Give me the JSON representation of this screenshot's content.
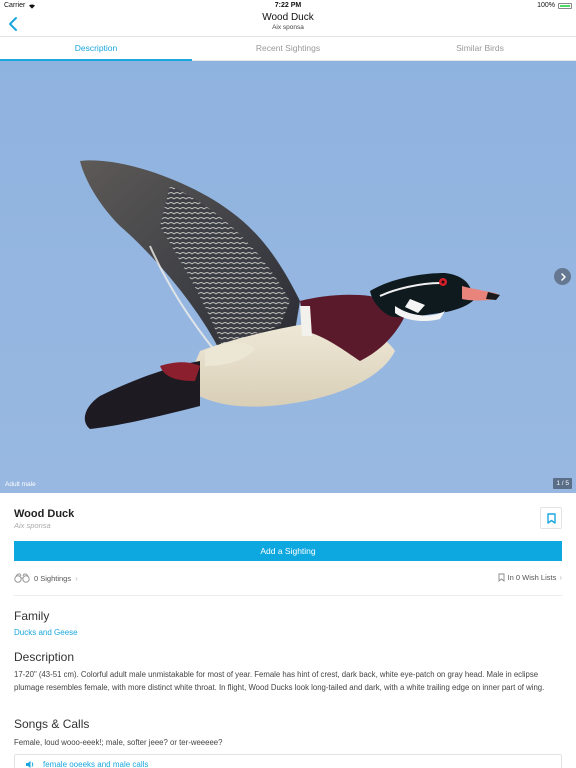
{
  "status_bar": {
    "carrier": "Carrier",
    "time": "7:22 PM",
    "battery": "100%"
  },
  "nav": {
    "title": "Wood Duck",
    "subtitle": "Aix sponsa",
    "back_icon": "chevron-left-icon"
  },
  "tabs": [
    {
      "label": "Description",
      "active": true
    },
    {
      "label": "Recent Sightings",
      "active": false
    },
    {
      "label": "Similar Birds",
      "active": false
    }
  ],
  "gallery": {
    "caption": "Adult male",
    "counter": "1 / 5",
    "current": 1,
    "total": 5
  },
  "bird": {
    "name": "Wood Duck",
    "scientific_name": "Aix sponsa",
    "add_sighting_label": "Add a Sighting",
    "sightings_label": "0 Sightings",
    "wishlists_label": "In 0 Wish Lists"
  },
  "sections": {
    "family": {
      "heading": "Family",
      "value": "Ducks and Geese"
    },
    "description": {
      "heading": "Description",
      "text": "17-20\" (43-51 cm). Colorful adult male unmistakable for most of year. Female has hint of crest, dark back, white eye-patch on gray head. Male in eclipse plumage resembles female, with more distinct white throat. In flight, Wood Ducks look long-tailed and dark, with a white trailing edge on inner part of wing."
    },
    "songs": {
      "heading": "Songs & Calls",
      "text": "Female, loud wooo-eeek!; male, softer jeee? or ter-weeeee?",
      "audio": [
        {
          "label": "female ooeeks and male calls"
        }
      ]
    }
  },
  "colors": {
    "accent": "#1aa7df",
    "button": "#0ea8e0",
    "sky": "#94b6e0"
  }
}
